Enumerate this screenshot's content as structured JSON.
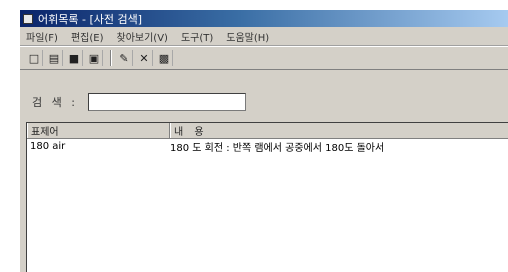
{
  "window": {
    "title": "어휘목록 - [사전 검색]"
  },
  "menu": {
    "items": [
      "파일(F)",
      "편집(E)",
      "찾아보기(V)",
      "도구(T)",
      "도움말(H)"
    ]
  },
  "toolbar": {
    "icons": [
      "new-icon",
      "open-icon",
      "save-icon",
      "print-icon",
      "edit-icon",
      "delete-icon",
      "disk-icon"
    ]
  },
  "search": {
    "label": "검 색 :",
    "value": ""
  },
  "list": {
    "columns": [
      "표제어",
      "내 용"
    ],
    "rows": [
      {
        "term": "180 air",
        "content": "180 도 회전 : 반쪽 램에서 공중에서 180도 돌아서"
      }
    ]
  }
}
